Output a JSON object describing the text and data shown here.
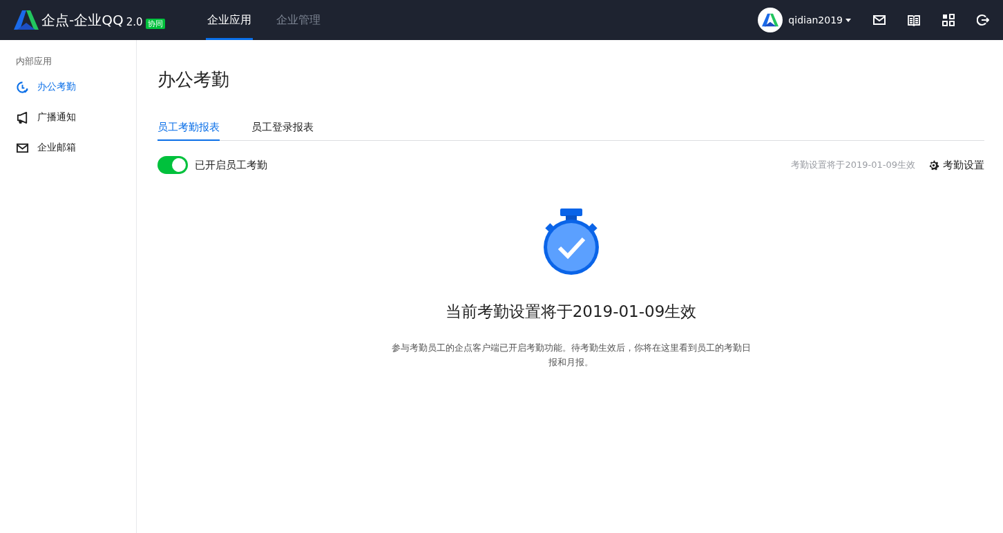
{
  "header": {
    "logo_text": "企点-企业QQ",
    "version": "2.0",
    "badge": "协同",
    "nav": [
      {
        "label": "企业应用",
        "selected": true
      },
      {
        "label": "企业管理",
        "selected": false
      }
    ],
    "user": "qidian2019"
  },
  "sidebar": {
    "section_title": "内部应用",
    "items": [
      {
        "label": "办公考勤",
        "kind": "clock",
        "selected": true
      },
      {
        "label": "广播通知",
        "kind": "megaphone",
        "selected": false
      },
      {
        "label": "企业邮箱",
        "kind": "mail",
        "selected": false
      }
    ]
  },
  "main": {
    "title": "办公考勤",
    "tabs": [
      {
        "label": "员工考勤报表",
        "selected": true
      },
      {
        "label": "员工登录报表",
        "selected": false
      }
    ],
    "toggle": {
      "label": "已开启员工考勤",
      "on": true
    },
    "effective_note": "考勤设置将于2019-01-09生效",
    "settings_button": "考勤设置",
    "empty_state": {
      "title": "当前考勤设置将于2019-01-09生效",
      "description": "参与考勤员工的企点客户端已开启考勤功能。待考勤生效后，你将在这里看到员工的考勤日报和月报。"
    }
  }
}
